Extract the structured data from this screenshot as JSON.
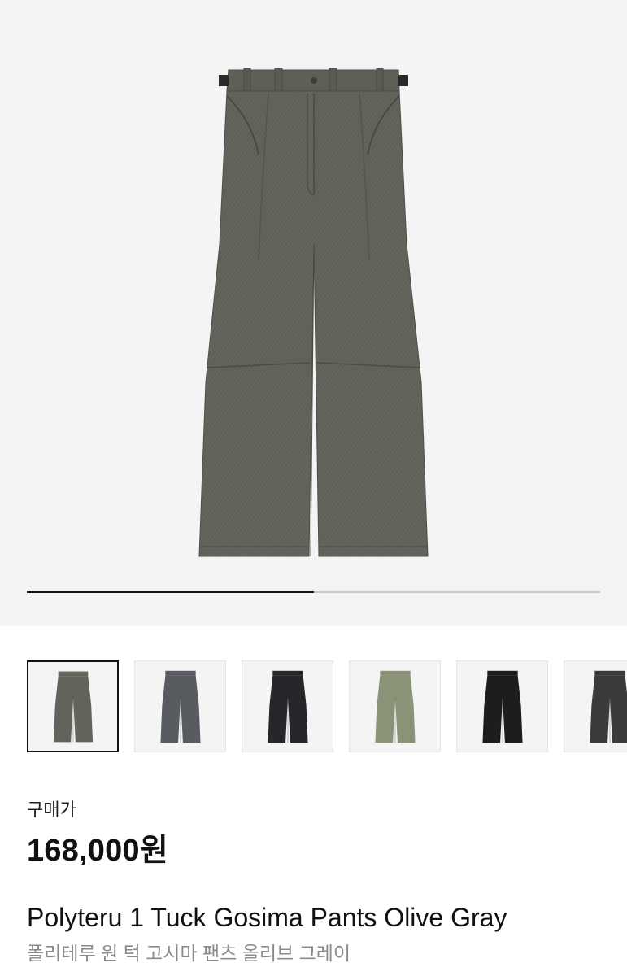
{
  "hero": {
    "image_alt": "pants-photo",
    "carousel_progress": 0.5,
    "colors": {
      "background": "#f4f4f4",
      "track": "#c9c9c9",
      "fill": "#111111"
    }
  },
  "thumbnails": [
    {
      "color": "#63635b",
      "selected": true
    },
    {
      "color": "#585b60",
      "selected": false
    },
    {
      "color": "#26272a",
      "selected": false
    },
    {
      "color": "#8a9278",
      "selected": false
    },
    {
      "color": "#1d1d1f",
      "selected": false
    },
    {
      "color": "#3a3a3c",
      "selected": false
    }
  ],
  "price": {
    "label": "구매가",
    "value": "168,000원"
  },
  "product": {
    "name_en": "Polyteru 1 Tuck Gosima Pants Olive Gray",
    "name_ko": "폴리테루 원 턱 고시마 팬츠 올리브 그레이"
  }
}
